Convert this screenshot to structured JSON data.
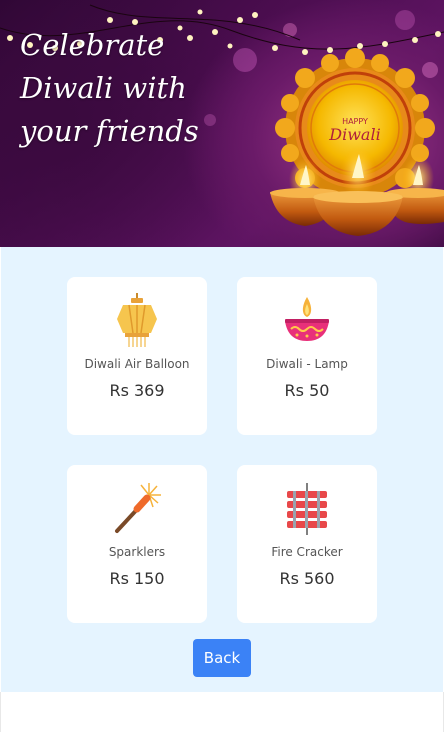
{
  "banner": {
    "title_line1": "Celebrate",
    "title_line2": "Diwali with",
    "title_line3": "your friends",
    "badge_line1": "HAPPY",
    "badge_line2": "Diwali"
  },
  "products": [
    {
      "name": "Diwali Air Balloon",
      "price": "Rs 369",
      "icon": "lantern-icon"
    },
    {
      "name": "Diwali - Lamp",
      "price": "Rs 50",
      "icon": "diya-lamp-icon"
    },
    {
      "name": "Sparklers",
      "price": "Rs 150",
      "icon": "sparkler-icon"
    },
    {
      "name": "Fire Cracker",
      "price": "Rs 560",
      "icon": "firecracker-icon"
    }
  ],
  "actions": {
    "back_label": "Back"
  },
  "colors": {
    "content_bg": "#e5f4ff",
    "accent": "#3b82f6",
    "card_bg": "#ffffff"
  }
}
